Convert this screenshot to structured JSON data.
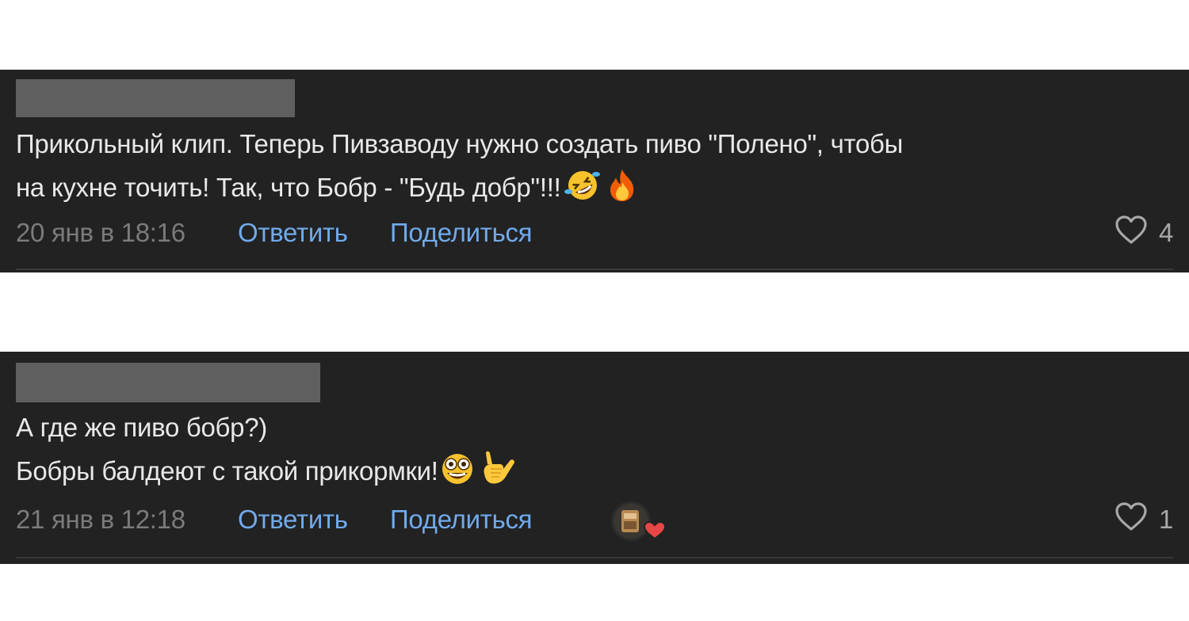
{
  "comments": [
    {
      "author_redacted": true,
      "text_line1": "Прикольный клип. Теперь Пивзаводу нужно создать пиво \"Полено\", чтобы",
      "text_line2": "на кухне точить! Так, что Бобр - \"Будь добр\"!!!",
      "emojis": [
        "rolling-on-floor-laughing-emoji",
        "fire-emoji"
      ],
      "date": "20 янв в 18:16",
      "reply_label": "Ответить",
      "share_label": "Поделиться",
      "like_count": "4"
    },
    {
      "author_redacted": true,
      "text_line1": "А где же пиво бобр?)",
      "text_line2": "Бобры балдеют с такой прикормки!",
      "emojis": [
        "crazy-face-emoji",
        "call-me-hand-emoji"
      ],
      "date": "21 янв в 12:18",
      "reply_label": "Ответить",
      "share_label": "Поделиться",
      "like_count": "1",
      "liked_by_author": true
    }
  ],
  "colors": {
    "background": "#222222",
    "text": "#e8e8e8",
    "link": "#71aaeb",
    "muted": "#7b7b7b",
    "redaction": "#5f5f5f"
  }
}
